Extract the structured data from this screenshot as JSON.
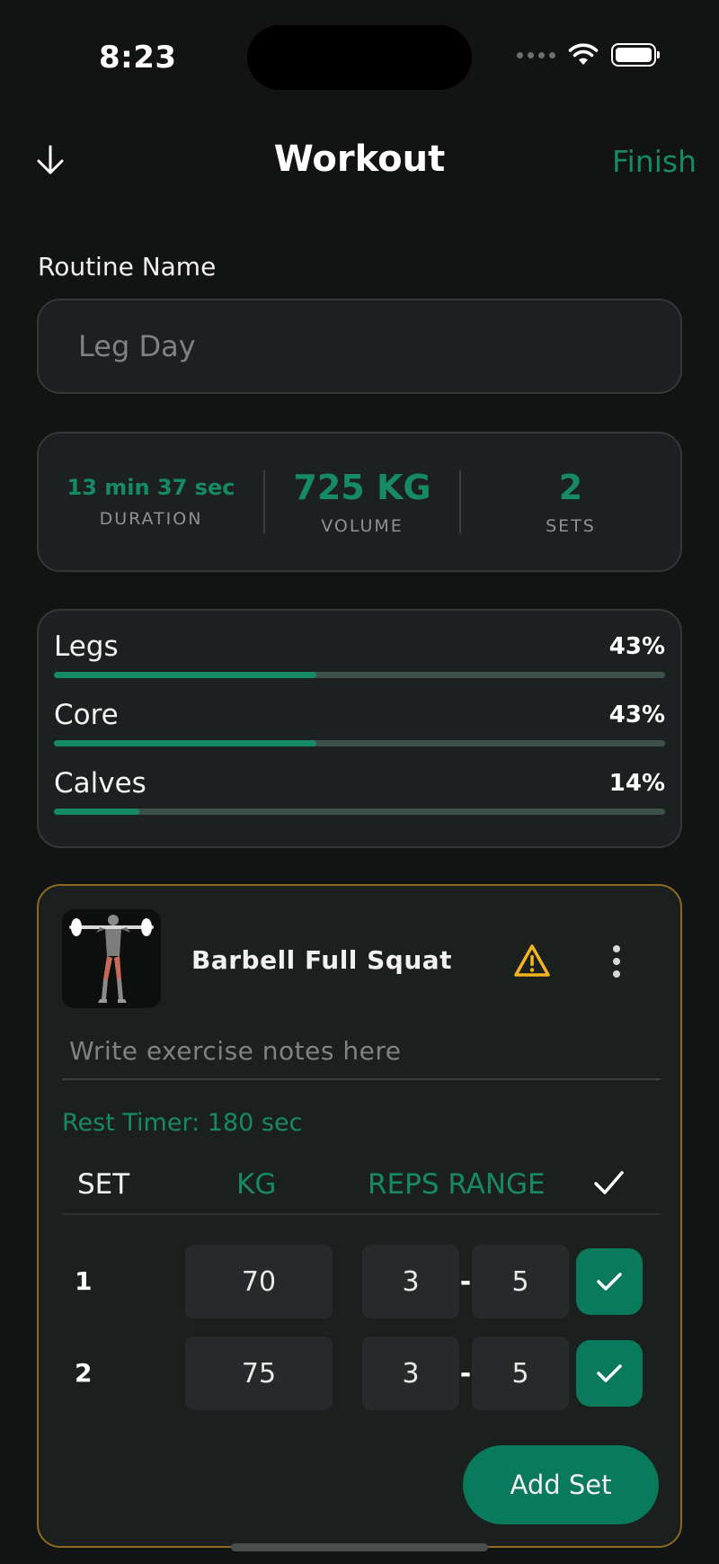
{
  "status_bar": {
    "time": "8:23",
    "icons": [
      "signal-dots-icon",
      "wifi-icon",
      "battery-icon"
    ]
  },
  "header": {
    "back_icon": "arrow-down-icon",
    "title": "Workout",
    "finish_label": "Finish"
  },
  "routine": {
    "label": "Routine Name",
    "value": "Leg Day"
  },
  "stats": {
    "duration": {
      "value": "13 min 37 sec",
      "label": "DURATION"
    },
    "volume": {
      "value": "725 KG",
      "label": "VOLUME"
    },
    "sets": {
      "value": "2",
      "label": "SETS"
    }
  },
  "muscles": [
    {
      "name": "Legs",
      "percent_label": "43%",
      "fraction": 0.43
    },
    {
      "name": "Core",
      "percent_label": "43%",
      "fraction": 0.43
    },
    {
      "name": "Calves",
      "percent_label": "14%",
      "fraction": 0.14
    }
  ],
  "exercise": {
    "name": "Barbell Full Squat",
    "thumbnail_icon": "squat-figure-icon",
    "notes_placeholder": "Write exercise notes here",
    "rest_timer": "Rest Timer: 180 sec",
    "columns": {
      "set": "SET",
      "kg": "KG",
      "reps": "REPS RANGE"
    },
    "sets": [
      {
        "number": "1",
        "kg": "70",
        "reps_min": "3",
        "reps_max": "5",
        "completed": true
      },
      {
        "number": "2",
        "kg": "75",
        "reps_min": "3",
        "reps_max": "5",
        "completed": true
      }
    ],
    "reps_separator": "-",
    "add_set_label": "Add Set"
  },
  "colors": {
    "accent": "#168a64",
    "button": "#097a5c",
    "warning": "#f2b41f",
    "card_border_active": "#8b6a1e",
    "background": "#121313"
  }
}
